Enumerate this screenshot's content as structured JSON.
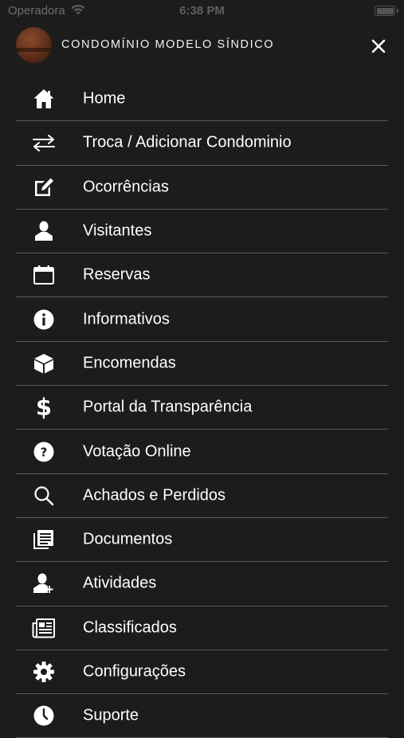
{
  "status_bar": {
    "carrier": "Operadora",
    "time": "6:38 PM"
  },
  "header": {
    "title": "CONDOMÍNIO MODELO SÍNDICO"
  },
  "menu": {
    "items": [
      {
        "label": "Home",
        "icon": "home-icon"
      },
      {
        "label": "Troca / Adicionar Condominio",
        "icon": "swap-arrows-icon"
      },
      {
        "label": "Ocorrências",
        "icon": "edit-note-icon"
      },
      {
        "label": "Visitantes",
        "icon": "person-icon"
      },
      {
        "label": "Reservas",
        "icon": "calendar-icon"
      },
      {
        "label": "Informativos",
        "icon": "info-icon"
      },
      {
        "label": "Encomendas",
        "icon": "package-icon"
      },
      {
        "label": "Portal da Transparência",
        "icon": "dollar-icon"
      },
      {
        "label": "Votação Online",
        "icon": "question-icon"
      },
      {
        "label": "Achados e Perdidos",
        "icon": "search-icon"
      },
      {
        "label": "Documentos",
        "icon": "document-list-icon"
      },
      {
        "label": "Atividades",
        "icon": "person-add-icon"
      },
      {
        "label": "Classificados",
        "icon": "newspaper-icon"
      },
      {
        "label": "Configurações",
        "icon": "gear-icon"
      },
      {
        "label": "Suporte",
        "icon": "support-icon"
      }
    ]
  }
}
